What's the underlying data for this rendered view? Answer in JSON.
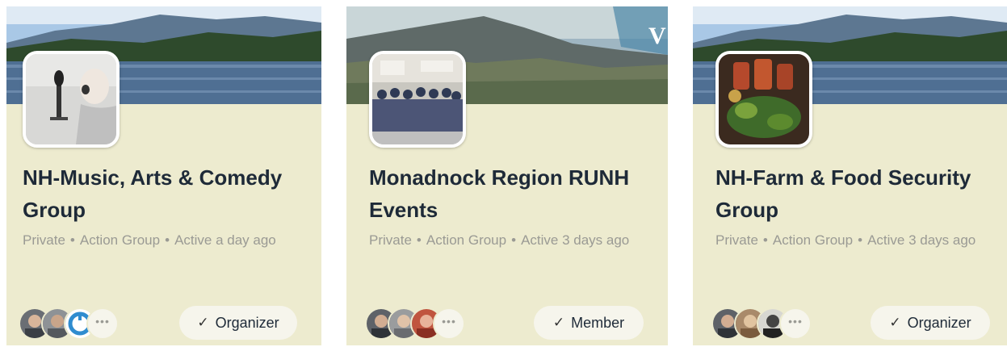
{
  "groups": [
    {
      "title": "NH-Music, Arts & Comedy Group",
      "meta": {
        "privacy": "Private",
        "type": "Action Group",
        "activity": "Active a day ago"
      },
      "role": "Organizer",
      "more_icon": "•••"
    },
    {
      "title": "Monadnock Region RUNH Events",
      "meta": {
        "privacy": "Private",
        "type": "Action Group",
        "activity": "Active 3 days ago"
      },
      "role": "Member",
      "more_icon": "•••"
    },
    {
      "title": "NH-Farm & Food Security Group",
      "meta": {
        "privacy": "Private",
        "type": "Action Group",
        "activity": "Active 3 days ago"
      },
      "role": "Organizer",
      "more_icon": "•••"
    }
  ],
  "separator": "•",
  "check_icon": "✓",
  "colors": {
    "card_bg": "#edebcf",
    "title": "#1e2a38",
    "meta": "#9a9a94",
    "pill_bg": "#f6f5ec"
  }
}
